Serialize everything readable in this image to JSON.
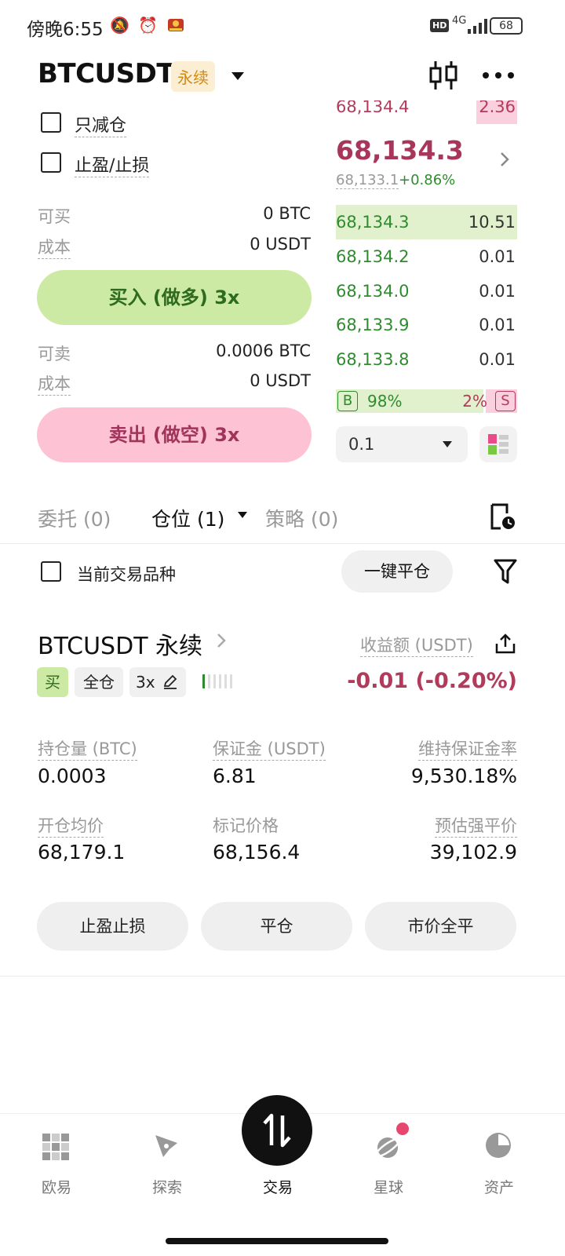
{
  "status_bar": {
    "time": "傍晚6:55",
    "network": "4G",
    "hd": "HD",
    "battery": "68"
  },
  "header": {
    "pair": "BTCUSDT",
    "contract_type": "永续"
  },
  "order_form": {
    "reduce_only_label": "只减仓",
    "tp_sl_label": "止盈/止损",
    "can_buy_label": "可买",
    "can_buy_value": "0 BTC",
    "cost_label_buy": "成本",
    "cost_value_buy": "0 USDT",
    "buy_button": "买入 (做多) 3x",
    "can_sell_label": "可卖",
    "can_sell_value": "0.0006 BTC",
    "cost_label_sell": "成本",
    "cost_value_sell": "0 USDT",
    "sell_button": "卖出 (做空) 3x"
  },
  "order_book": {
    "top_ask_price": "68,134.4",
    "top_ask_qty": "2.36",
    "last_price": "68,134.3",
    "mark_price": "68,133.1",
    "change": "+0.86%",
    "bids": [
      {
        "price": "68,134.3",
        "qty": "10.51"
      },
      {
        "price": "68,134.2",
        "qty": "0.01"
      },
      {
        "price": "68,134.0",
        "qty": "0.01"
      },
      {
        "price": "68,133.9",
        "qty": "0.01"
      },
      {
        "price": "68,133.8",
        "qty": "0.01"
      }
    ],
    "buy_ratio": "98%",
    "sell_ratio": "2%",
    "buy_ratio_fraction": 0.98,
    "b_label": "B",
    "s_label": "S",
    "depth_step": "0.1"
  },
  "tabs": {
    "orders": "委托 (0)",
    "positions": "仓位 (1)",
    "strategies": "策略 (0)"
  },
  "filter": {
    "current_symbol_label": "当前交易品种",
    "close_all_button": "一键平仓"
  },
  "position": {
    "symbol": "BTCUSDT 永续",
    "pnl_label": "收益额 (USDT)",
    "side_tag": "买",
    "margin_mode_tag": "全仓",
    "leverage_tag": "3x",
    "pnl_value": "-0.01 (-0.20%)",
    "stats": [
      {
        "label": "持仓量 (BTC)",
        "value": "0.0003"
      },
      {
        "label": "保证金 (USDT)",
        "value": "6.81"
      },
      {
        "label": "维持保证金率",
        "value": "9,530.18%"
      },
      {
        "label": "开仓均价",
        "value": "68,179.1"
      },
      {
        "label": "标记价格",
        "value": "68,156.4"
      },
      {
        "label": "预估强平价",
        "value": "39,102.9"
      }
    ],
    "tp_sl_button": "止盈止损",
    "close_button": "平仓",
    "market_close_all_button": "市价全平"
  },
  "bottom_nav": {
    "items": [
      "欧易",
      "探索",
      "交易",
      "星球",
      "资产"
    ]
  },
  "colors": {
    "buy_green": "#2e8b2e",
    "sell_red": "#b23a5b",
    "buy_button_bg": "#cdeaa4",
    "sell_button_bg": "#fdc3d5"
  }
}
